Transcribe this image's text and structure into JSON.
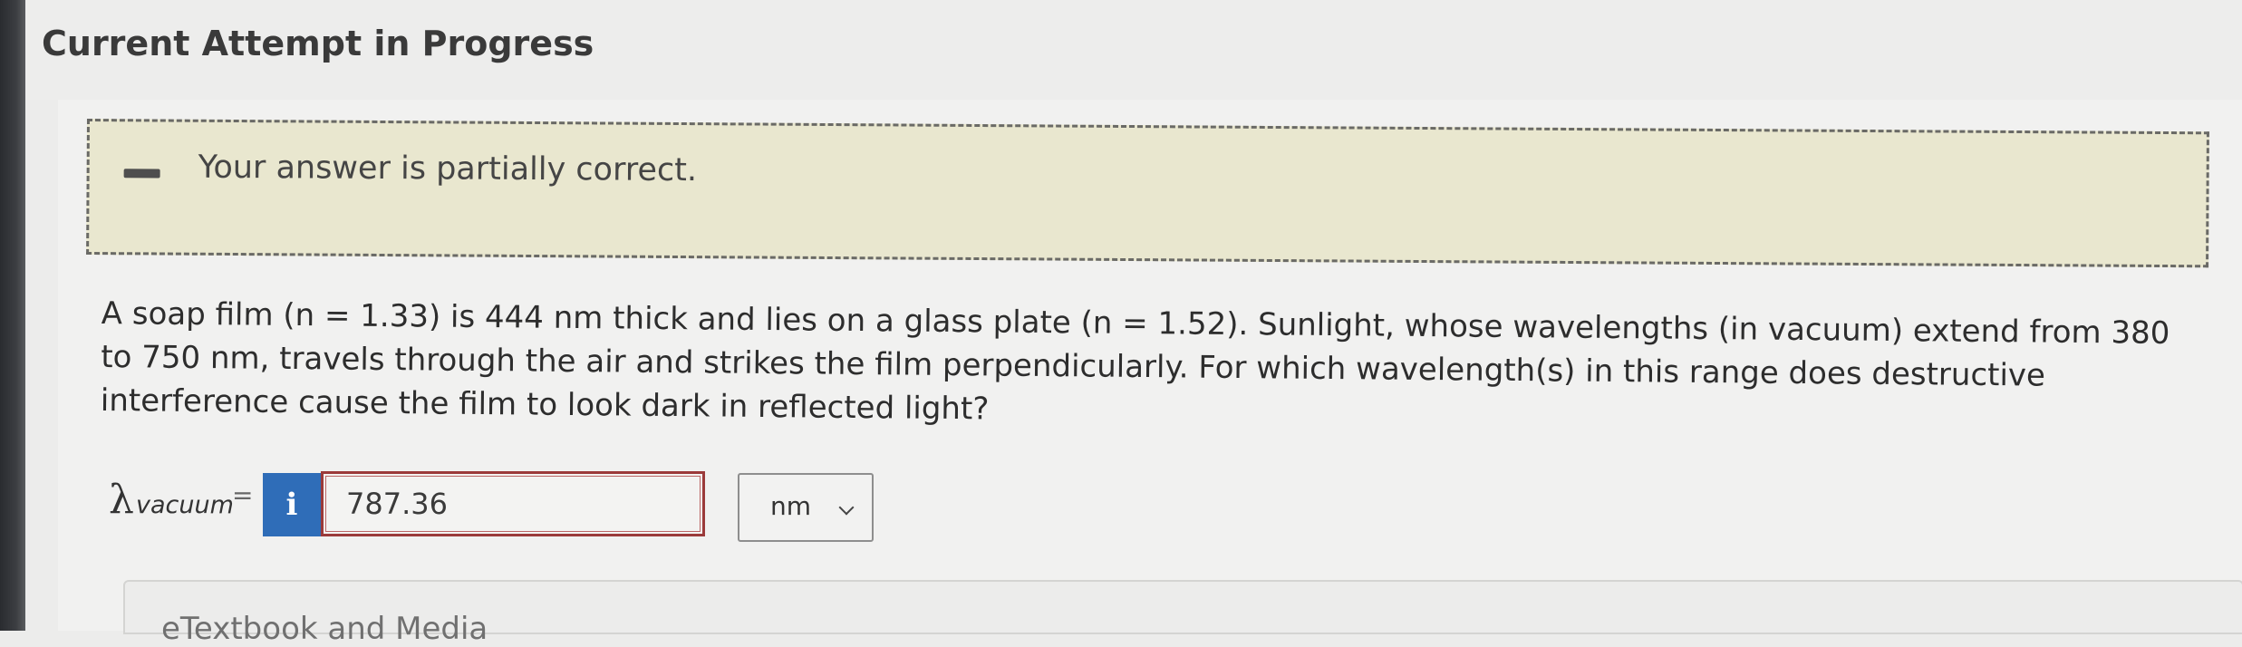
{
  "page": {
    "title": "Current Attempt in Progress"
  },
  "feedback": {
    "icon": "partial-dash-icon",
    "message": "Your answer is partially correct."
  },
  "question": {
    "line1": "A soap film (n = 1.33) is 444 nm thick and lies on a glass plate (n = 1.52). Sunlight, whose wavelengths (in vacuum) extend from 380",
    "line2": "to 750 nm, travels through the air and strikes the film perpendicularly. For which wavelength(s) in this range does destructive",
    "line3": "interference cause the film to look dark in reflected light?"
  },
  "answer": {
    "symbol": "λ",
    "subscript": "vacuum",
    "equals": "=",
    "info_label": "i",
    "value": "787.36",
    "unit": "nm"
  },
  "resources": {
    "label": "eTextbook and Media"
  }
}
